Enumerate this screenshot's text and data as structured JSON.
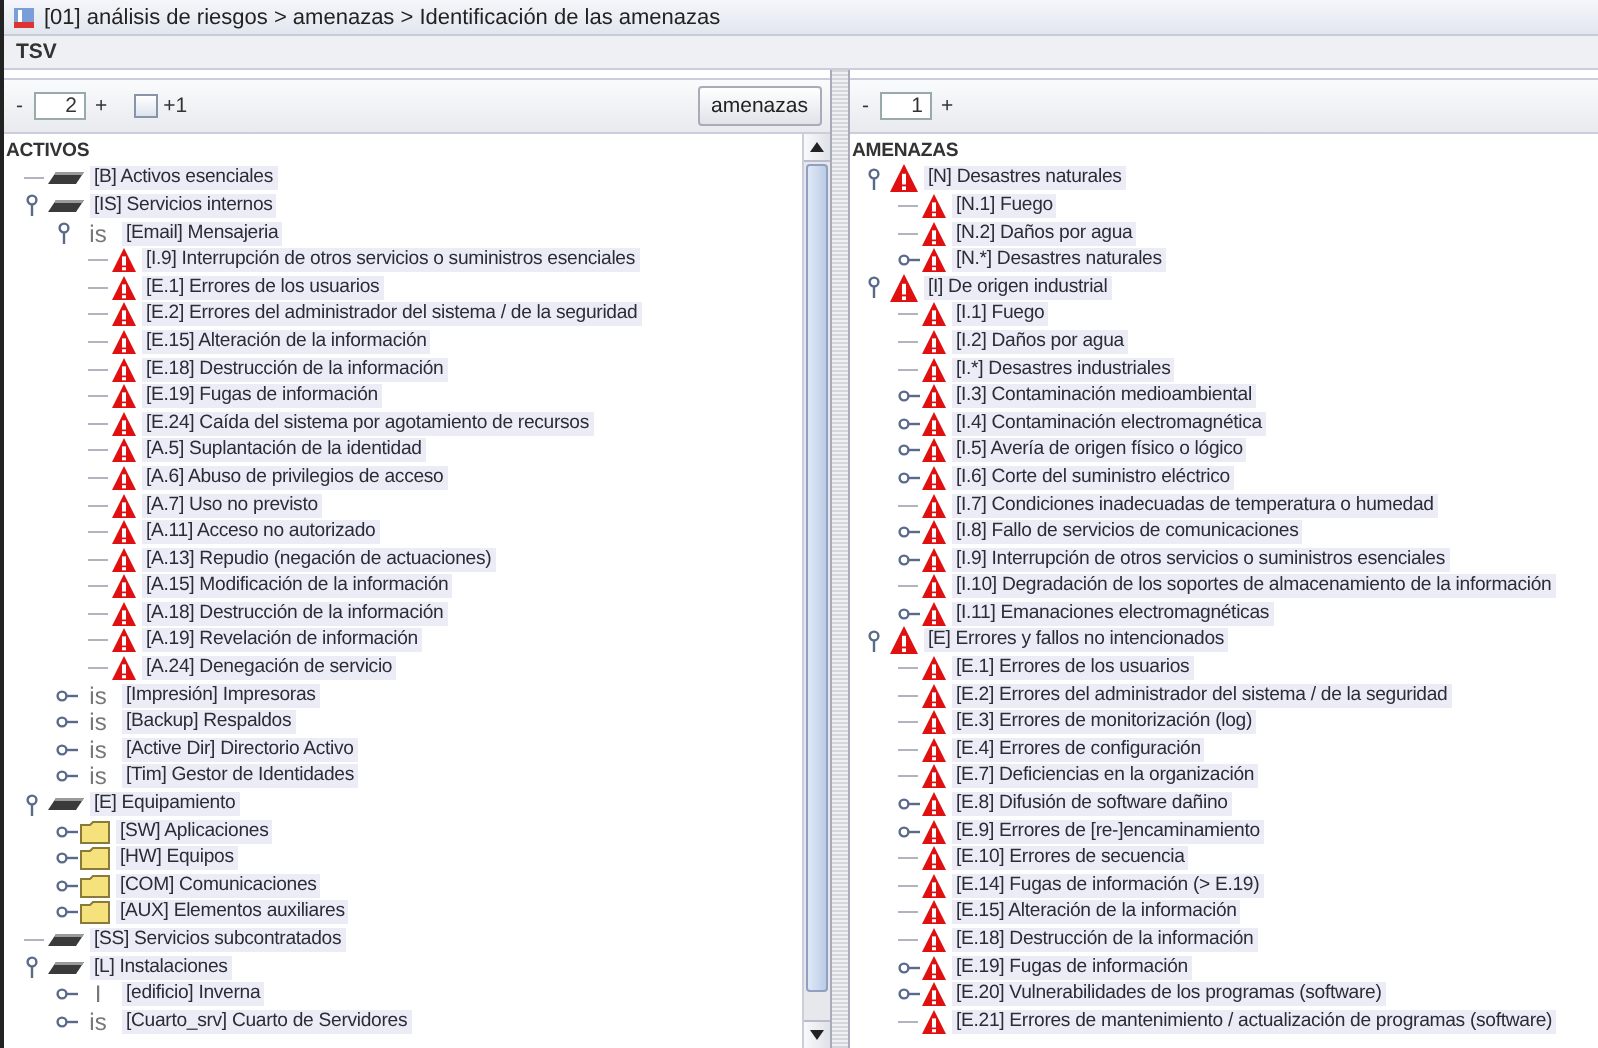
{
  "window": {
    "title": "[01] análisis de riesgos > amenazas > Identificación de las amenazas"
  },
  "menu": [
    "TSV"
  ],
  "left_panel": {
    "toolbar": {
      "decrement": "-",
      "depth": "2",
      "increment": "+",
      "plus_one": {
        "label": "+1",
        "checked": false
      },
      "button": "amenazas"
    },
    "tree": {
      "root": "ACTIVOS",
      "nodes": [
        {
          "kind": "disk",
          "label": "[B] Activos esenciales"
        },
        {
          "kind": "disk",
          "label": "[IS] Servicios internos",
          "expanded": true,
          "children": [
            {
              "kind": "badge",
              "badge": "is",
              "label": "[Email] Mensajeria",
              "expanded": true,
              "children": [
                {
                  "kind": "threat",
                  "label": "[I.9] Interrupción de otros servicios o suministros esenciales"
                },
                {
                  "kind": "threat",
                  "label": "[E.1] Errores de los usuarios"
                },
                {
                  "kind": "threat",
                  "label": "[E.2] Errores del administrador del sistema / de la seguridad"
                },
                {
                  "kind": "threat",
                  "label": "[E.15] Alteración de la información"
                },
                {
                  "kind": "threat",
                  "label": "[E.18] Destrucción de la información"
                },
                {
                  "kind": "threat",
                  "label": "[E.19] Fugas de información"
                },
                {
                  "kind": "threat",
                  "label": "[E.24] Caída del sistema por agotamiento de recursos"
                },
                {
                  "kind": "threat",
                  "label": "[A.5] Suplantación de la identidad"
                },
                {
                  "kind": "threat",
                  "label": "[A.6] Abuso de privilegios de acceso"
                },
                {
                  "kind": "threat",
                  "label": "[A.7] Uso no previsto"
                },
                {
                  "kind": "threat",
                  "label": "[A.11] Acceso no autorizado"
                },
                {
                  "kind": "threat",
                  "label": "[A.13] Repudio (negación de actuaciones)"
                },
                {
                  "kind": "threat",
                  "label": "[A.15] Modificación de la información"
                },
                {
                  "kind": "threat",
                  "label": "[A.18] Destrucción de la información"
                },
                {
                  "kind": "threat",
                  "label": "[A.19] Revelación de información"
                },
                {
                  "kind": "threat",
                  "label": "[A.24] Denegación de servicio"
                }
              ]
            },
            {
              "kind": "badge",
              "badge": "is",
              "label": "[Impresión] Impresoras",
              "expanded": false
            },
            {
              "kind": "badge",
              "badge": "is",
              "label": "[Backup] Respaldos",
              "expanded": false
            },
            {
              "kind": "badge",
              "badge": "is",
              "label": "[Active Dir] Directorio Activo",
              "expanded": false
            },
            {
              "kind": "badge",
              "badge": "is",
              "label": "[Tim] Gestor de Identidades",
              "expanded": false
            }
          ]
        },
        {
          "kind": "disk",
          "label": "[E] Equipamiento",
          "expanded": true,
          "children": [
            {
              "kind": "folder",
              "label": "[SW] Aplicaciones",
              "expanded": false
            },
            {
              "kind": "folder",
              "label": "[HW] Equipos",
              "expanded": false
            },
            {
              "kind": "folder",
              "label": "[COM] Comunicaciones",
              "expanded": false
            },
            {
              "kind": "folder",
              "label": "[AUX] Elementos auxiliares",
              "expanded": false
            }
          ]
        },
        {
          "kind": "disk",
          "label": "[SS] Servicios subcontratados"
        },
        {
          "kind": "disk",
          "label": "[L] Instalaciones",
          "expanded": true,
          "children": [
            {
              "kind": "badge",
              "badge": "I",
              "label": "[edificio] Inverna",
              "expanded": false
            },
            {
              "kind": "badge",
              "badge": "is",
              "label": "[Cuarto_srv] Cuarto de Servidores",
              "expanded": false
            }
          ]
        }
      ]
    }
  },
  "right_panel": {
    "toolbar": {
      "decrement": "-",
      "depth": "1",
      "increment": "+"
    },
    "tree": {
      "root": "AMENAZAS",
      "nodes": [
        {
          "kind": "threat",
          "label": "[N] Desastres naturales",
          "expanded": true,
          "children": [
            {
              "kind": "threat",
              "label": "[N.1] Fuego"
            },
            {
              "kind": "threat",
              "label": "[N.2] Daños por agua"
            },
            {
              "kind": "threat",
              "label": "[N.*] Desastres naturales",
              "expanded": false
            }
          ]
        },
        {
          "kind": "threat",
          "label": "[I] De origen industrial",
          "expanded": true,
          "children": [
            {
              "kind": "threat",
              "label": "[I.1] Fuego"
            },
            {
              "kind": "threat",
              "label": "[I.2] Daños por agua"
            },
            {
              "kind": "threat",
              "label": "[I.*] Desastres industriales"
            },
            {
              "kind": "threat",
              "label": "[I.3] Contaminación medioambiental",
              "expanded": false
            },
            {
              "kind": "threat",
              "label": "[I.4] Contaminación electromagnética",
              "expanded": false
            },
            {
              "kind": "threat",
              "label": "[I.5] Avería de origen físico o lógico",
              "expanded": false
            },
            {
              "kind": "threat",
              "label": "[I.6] Corte del suministro eléctrico",
              "expanded": false
            },
            {
              "kind": "threat",
              "label": "[I.7] Condiciones inadecuadas de temperatura o humedad"
            },
            {
              "kind": "threat",
              "label": "[I.8] Fallo de servicios de comunicaciones",
              "expanded": false
            },
            {
              "kind": "threat",
              "label": "[I.9] Interrupción de otros servicios o suministros esenciales",
              "expanded": false
            },
            {
              "kind": "threat",
              "label": "[I.10] Degradación de los soportes de almacenamiento de la información"
            },
            {
              "kind": "threat",
              "label": "[I.11] Emanaciones electromagnéticas",
              "expanded": false
            }
          ]
        },
        {
          "kind": "threat",
          "label": "[E] Errores y fallos no intencionados",
          "expanded": true,
          "children": [
            {
              "kind": "threat",
              "label": "[E.1] Errores de los usuarios"
            },
            {
              "kind": "threat",
              "label": "[E.2] Errores del administrador del sistema / de la seguridad"
            },
            {
              "kind": "threat",
              "label": "[E.3] Errores de monitorización (log)"
            },
            {
              "kind": "threat",
              "label": "[E.4] Errores de configuración"
            },
            {
              "kind": "threat",
              "label": "[E.7] Deficiencias en la organización"
            },
            {
              "kind": "threat",
              "label": "[E.8] Difusión de software dañino",
              "expanded": false
            },
            {
              "kind": "threat",
              "label": "[E.9] Errores de [re-]encaminamiento",
              "expanded": false
            },
            {
              "kind": "threat",
              "label": "[E.10] Errores de secuencia"
            },
            {
              "kind": "threat",
              "label": "[E.14] Fugas de información (> E.19)"
            },
            {
              "kind": "threat",
              "label": "[E.15] Alteración de la información"
            },
            {
              "kind": "threat",
              "label": "[E.18] Destrucción de la información"
            },
            {
              "kind": "threat",
              "label": "[E.19] Fugas de información",
              "expanded": false
            },
            {
              "kind": "threat",
              "label": "[E.20] Vulnerabilidades de los programas (software)",
              "expanded": false
            },
            {
              "kind": "threat",
              "label": "[E.21] Errores de mantenimiento / actualización de programas (software)"
            }
          ]
        }
      ]
    }
  }
}
